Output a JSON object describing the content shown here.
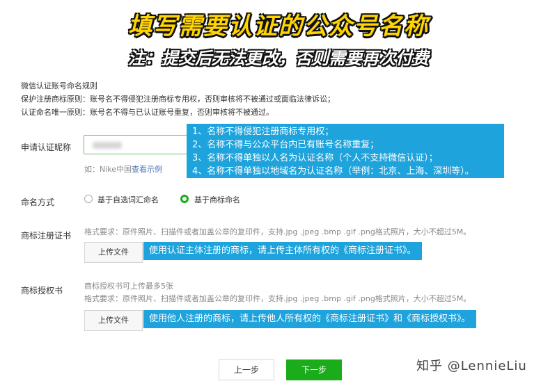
{
  "banner": {
    "title": "填写需要认证的公众号名称",
    "subtitle": "注：提交后无法更改，否则需要再次付费"
  },
  "rules": {
    "heading": "微信认证账号命名规则",
    "lines": [
      "保护注册商标原则：账号名不得侵犯注册商标专用权，否则审核将不被通过或面临法律诉讼；",
      "认证命名唯一原则：账号名不得与已认证账号重复，否则审核将不被通过。"
    ]
  },
  "nickname": {
    "label": "申请认证昵称",
    "hint_prefix": "如：Nike中国",
    "hint_link": "查看示例"
  },
  "callout_name": [
    "1、名称不得侵犯注册商标专用权；",
    "2、名称不得与公众平台内已有账号名称重复；",
    "3、名称不得单独以人名为认证名称（个人不支持微信认证）；",
    "4、名称不得单独以地域名为认证名称（举例：北京、上海、深圳等）。"
  ],
  "naming": {
    "label": "命名方式",
    "options": [
      "基于自选词汇命名",
      "基于商标命名"
    ],
    "selected": 1
  },
  "trademark_cert": {
    "label": "商标注册证书",
    "format": "格式要求：原件照片、扫描件或者加盖公章的复印件，支持.jpg .jpeg .bmp .gif .png格式照片，大小不超过5M。",
    "upload_label": "上传文件",
    "callout": "使用认证主体注册的商标，请上传主体所有权的《商标注册证书》。"
  },
  "trademark_auth": {
    "label": "商标授权书",
    "limit": "商标授权书可上传最多5张",
    "format": "格式要求：原件照片、扫描件或者加盖公章的复印件，支持.jpg .jpeg .bmp .gif .png格式照片，大小不超过5M。",
    "upload_label": "上传文件",
    "callout": "使用他人注册的商标，请上传他人所有权的《商标注册证书》和《商标授权书》。"
  },
  "buttons": {
    "prev": "上一步",
    "next": "下一步"
  },
  "watermark": "知乎 @LennieLiu",
  "colors": {
    "accent": "#1aad19",
    "callout": "#1ea3dc",
    "banner_yellow": "#ffd400"
  }
}
